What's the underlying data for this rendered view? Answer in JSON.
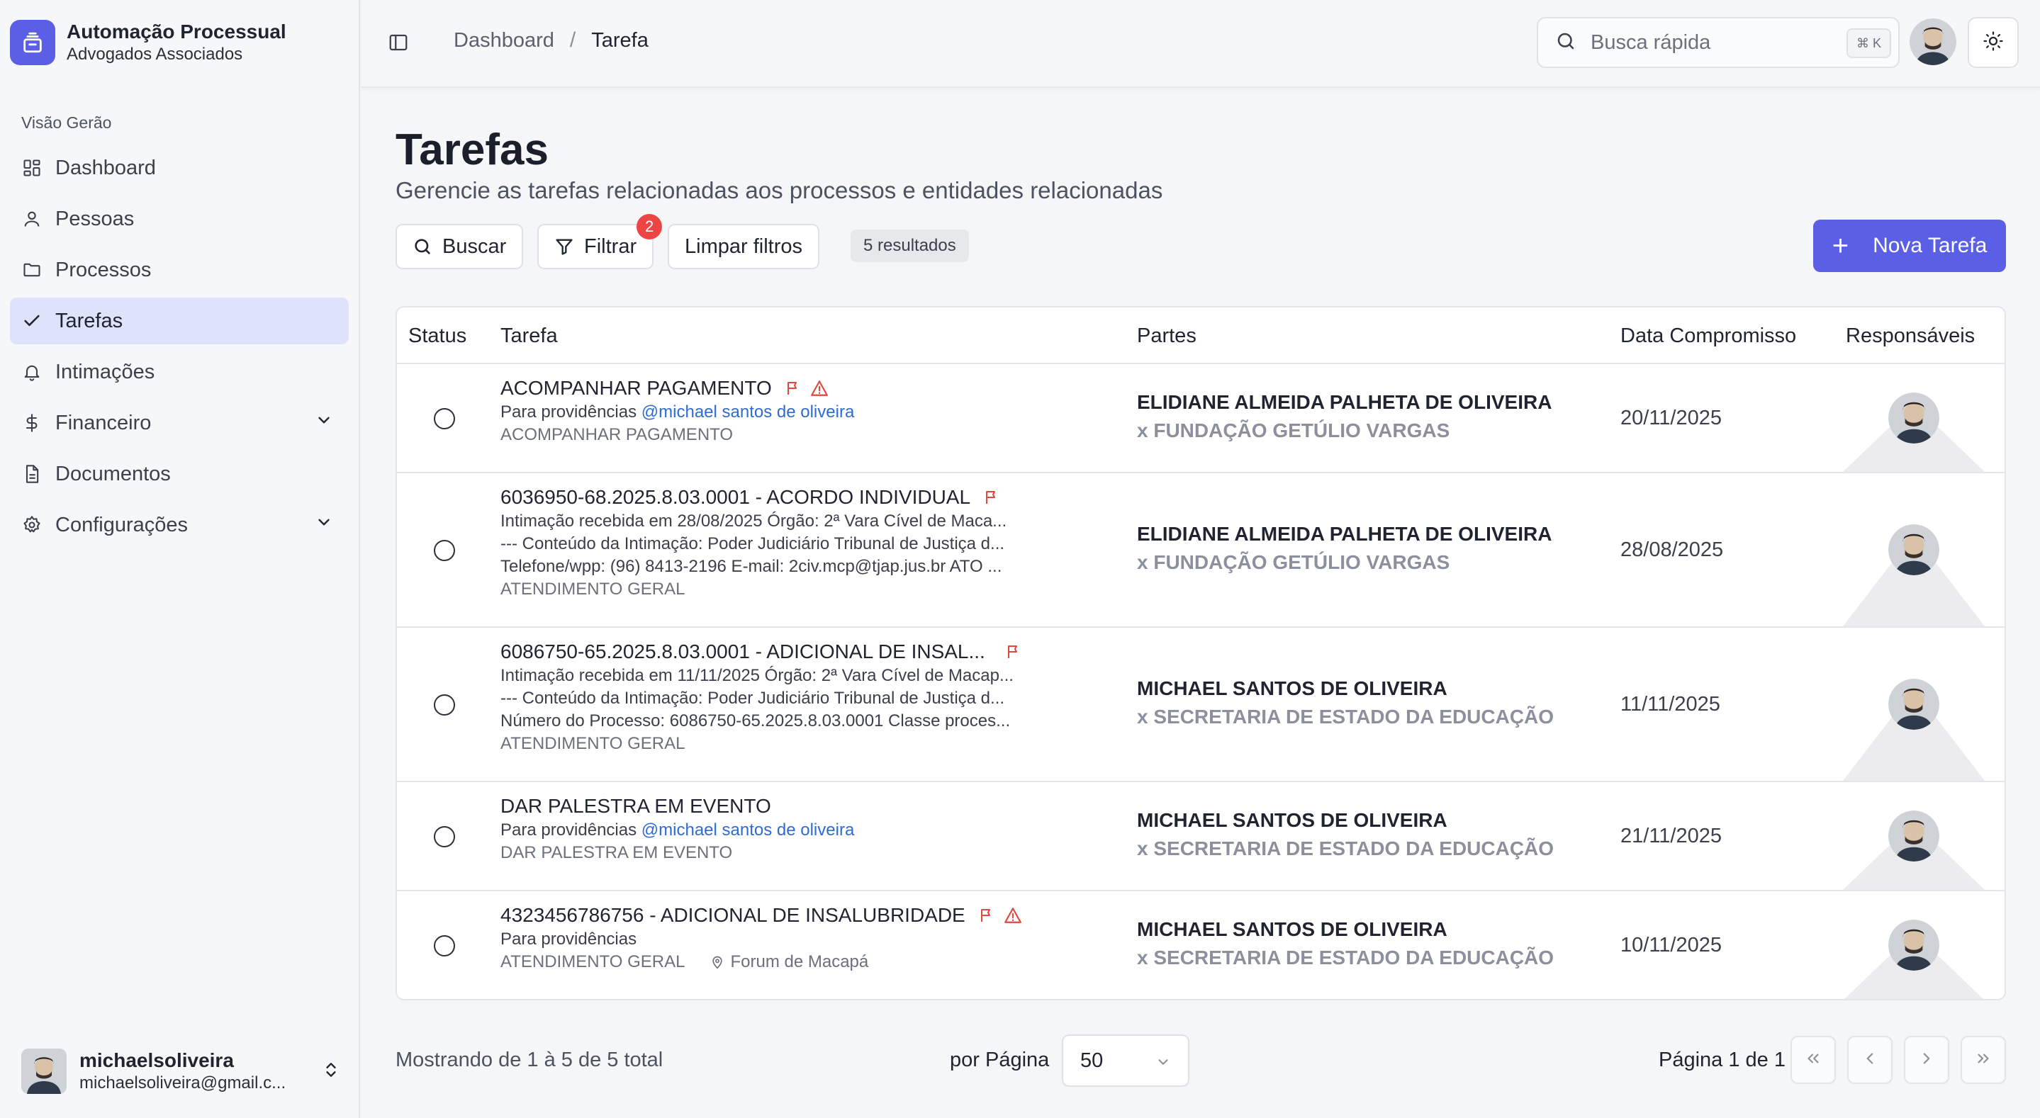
{
  "brand": {
    "title": "Automação Processual",
    "subtitle": "Advogados Associados"
  },
  "sidebar": {
    "section_label": "Visão Gerão",
    "items": [
      {
        "label": "Dashboard",
        "icon": "dashboard-icon"
      },
      {
        "label": "Pessoas",
        "icon": "user-icon"
      },
      {
        "label": "Processos",
        "icon": "folder-icon"
      },
      {
        "label": "Tarefas",
        "icon": "check-icon",
        "active": true
      },
      {
        "label": "Intimações",
        "icon": "bell-icon"
      },
      {
        "label": "Financeiro",
        "icon": "dollar-icon",
        "expandable": true
      },
      {
        "label": "Documentos",
        "icon": "document-icon"
      },
      {
        "label": "Configurações",
        "icon": "gear-icon",
        "expandable": true
      }
    ],
    "user": {
      "name": "michaelsoliveira",
      "email": "michaelsoliveira@gmail.c..."
    }
  },
  "header": {
    "breadcrumb": {
      "parent": "Dashboard",
      "separator": "/",
      "current": "Tarefa"
    },
    "search": {
      "placeholder": "Busca rápida",
      "shortcut": "⌘ K"
    }
  },
  "page": {
    "title": "Tarefas",
    "subtitle": "Gerencie as tarefas relacionadas aos processos e entidades relacionadas"
  },
  "toolbar": {
    "search_label": "Buscar",
    "filter_label": "Filtrar",
    "filter_count": "2",
    "clear_label": "Limpar filtros",
    "results": "5 resultados",
    "new_label": "Nova Tarefa"
  },
  "table": {
    "columns": {
      "status": "Status",
      "tarefa": "Tarefa",
      "partes": "Partes",
      "data": "Data Compromisso",
      "responsaveis": "Responsáveis"
    },
    "rows": [
      {
        "title": "ACOMPANHAR PAGAMENTO",
        "flag": true,
        "warning": true,
        "desc_prefix": "Para providências ",
        "mention": "@michael santos de oliveira",
        "category": "ACOMPANHAR PAGAMENTO",
        "parte_a": "ELIDIANE ALMEIDA PALHETA DE OLIVEIRA",
        "parte_b": "x FUNDAÇÃO GETÚLIO VARGAS",
        "date": "20/11/2025"
      },
      {
        "title": "6036950-68.2025.8.03.0001 - ACORDO INDIVIDUAL",
        "flag": true,
        "warning": false,
        "lines": [
          "Intimação recebida em 28/08/2025 Órgão: 2ª Vara Cível de Maca...",
          "--- Conteúdo da Intimação: Poder Judiciário Tribunal de Justiça d...",
          "Telefone/wpp: (96) 8413-2196 E-mail: 2civ.mcp@tjap.jus.br ATO ..."
        ],
        "category": "ATENDIMENTO GERAL",
        "parte_a": "ELIDIANE ALMEIDA PALHETA DE OLIVEIRA",
        "parte_b": "x FUNDAÇÃO GETÚLIO VARGAS",
        "date": "28/08/2025"
      },
      {
        "title": "6086750-65.2025.8.03.0001 - ADICIONAL DE INSAL...",
        "flag": true,
        "warning": false,
        "lines": [
          "Intimação recebida em 11/11/2025 Órgão: 2ª Vara Cível de Macap...",
          "--- Conteúdo da Intimação: Poder Judiciário Tribunal de Justiça d...",
          "Número do Processo: 6086750-65.2025.8.03.0001 Classe proces..."
        ],
        "category": "ATENDIMENTO GERAL",
        "parte_a": "MICHAEL SANTOS DE OLIVEIRA",
        "parte_b": "x SECRETARIA DE ESTADO DA EDUCAÇÃO",
        "date": "11/11/2025"
      },
      {
        "title": "DAR PALESTRA EM EVENTO",
        "flag": false,
        "warning": false,
        "desc_prefix": "Para providências ",
        "mention": "@michael santos de oliveira",
        "category": "DAR PALESTRA EM EVENTO",
        "parte_a": "MICHAEL SANTOS DE OLIVEIRA",
        "parte_b": "x SECRETARIA DE ESTADO DA EDUCAÇÃO",
        "date": "21/11/2025"
      },
      {
        "title": "4323456786756 - ADICIONAL DE INSALUBRIDADE",
        "flag": true,
        "warning": true,
        "desc_prefix": "Para providências",
        "category": "ATENDIMENTO GERAL",
        "location": "Forum de Macapá",
        "parte_a": "MICHAEL SANTOS DE OLIVEIRA",
        "parte_b": "x SECRETARIA DE ESTADO DA EDUCAÇÃO",
        "date": "10/11/2025"
      }
    ]
  },
  "pagination": {
    "showing": "Mostrando de 1 à 5 de 5 total",
    "per_page_label": "por Página",
    "per_page_value": "50",
    "page_info": "Página 1 de 1"
  },
  "colors": {
    "accent": "#5b5fe6",
    "danger": "#ef4444",
    "mention": "#2d6bd6"
  }
}
